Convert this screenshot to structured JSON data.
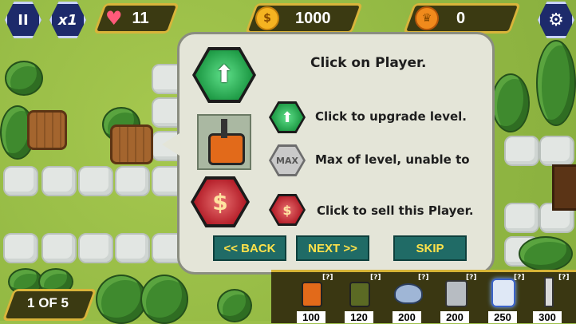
{
  "hud": {
    "pause_label": "II",
    "speed_label": "x1",
    "lives": "11",
    "gold": "1000",
    "gems": "0",
    "gold_icon_glyph": "$",
    "gem_icon_glyph": "♛"
  },
  "dialog": {
    "title": "Click on Player.",
    "line_upgrade": "Click to upgrade level.",
    "line_max": "Max of level, unable to",
    "max_badge": "MAX",
    "line_sell": "Click to sell this Player.",
    "sell_glyph": "$",
    "back_label": "<< BACK",
    "next_label": "NEXT >>",
    "skip_label": "SKIP"
  },
  "wave": {
    "label": "1 OF 5"
  },
  "shop": {
    "items": [
      {
        "name": "tank-1",
        "price": "100",
        "hint": "[?]"
      },
      {
        "name": "tank-2",
        "price": "120",
        "hint": "[?]"
      },
      {
        "name": "radar",
        "price": "200",
        "hint": "[?]"
      },
      {
        "name": "mech",
        "price": "200",
        "hint": "[?]"
      },
      {
        "name": "tesla",
        "price": "250",
        "hint": "[?]"
      },
      {
        "name": "missile",
        "price": "300",
        "hint": "[?]"
      }
    ]
  },
  "colors": {
    "accent_gold": "#d9b43a",
    "button_teal": "#206b66",
    "button_text": "#ffe24a"
  }
}
